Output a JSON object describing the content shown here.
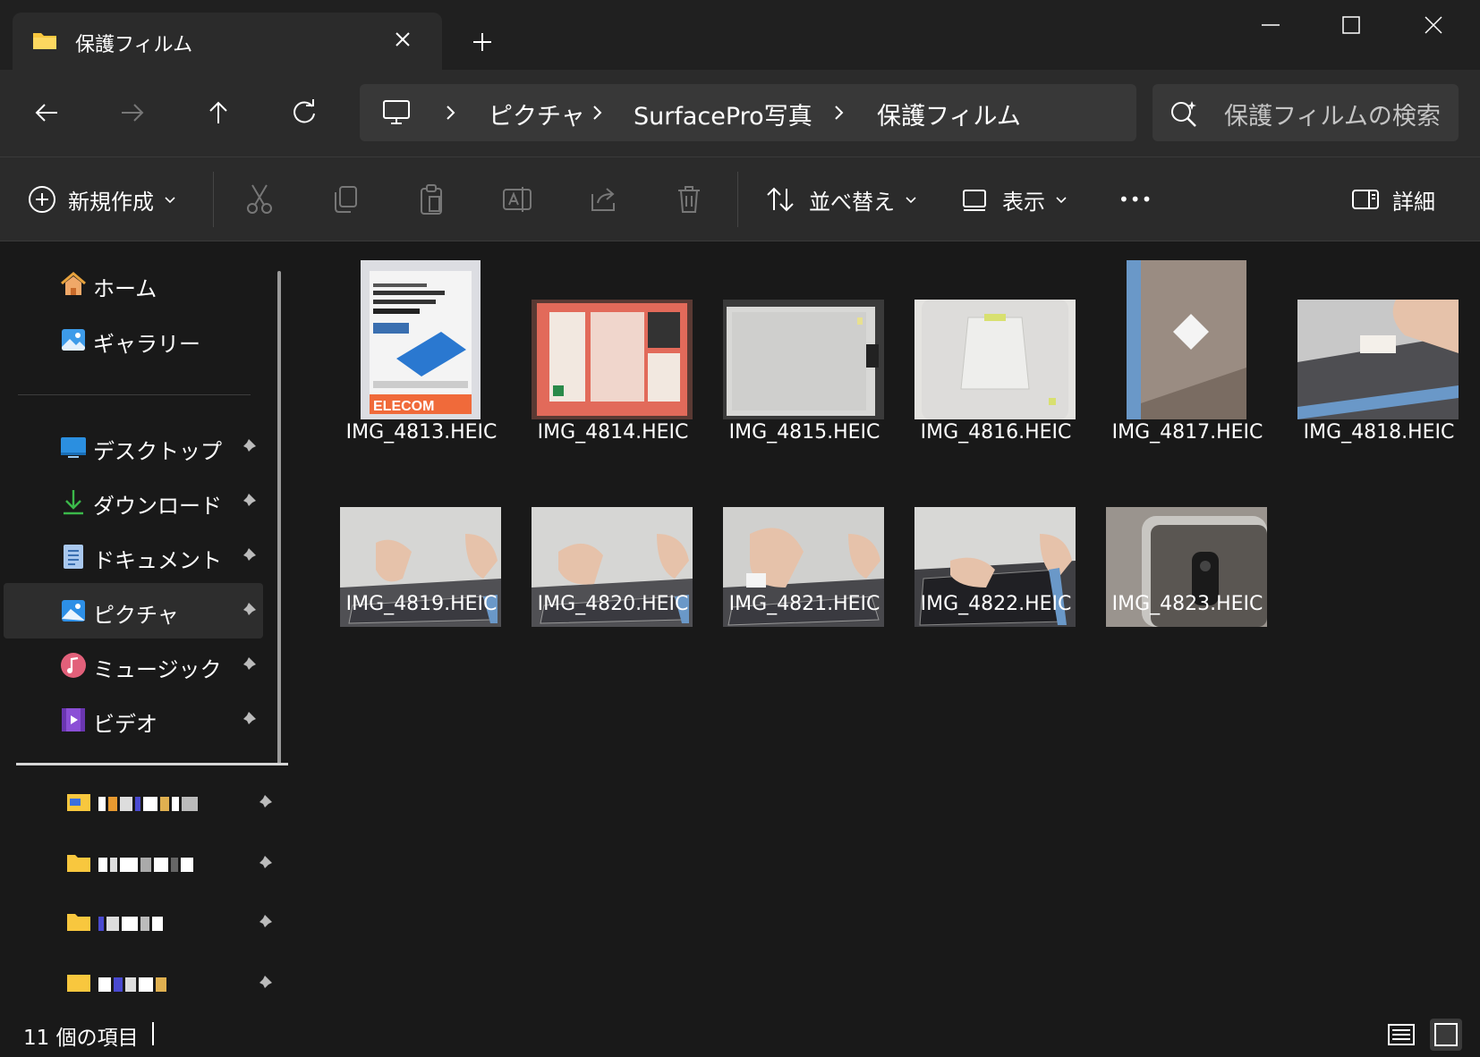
{
  "window": {
    "tab_title": "保護フィルム",
    "new_tab_glyph": "+"
  },
  "address_bar": {
    "crumbs": [
      "ピクチャ",
      "SurfacePro写真",
      "保護フィルム"
    ],
    "search_placeholder": "保護フィルムの検索"
  },
  "command_bar": {
    "new_label": "新規作成",
    "sort_label": "並べ替え",
    "view_label": "表示",
    "more_label": "•••",
    "details_label": "詳細"
  },
  "sidebar": {
    "top_items": [
      {
        "label": "ホーム",
        "icon": "home-icon"
      },
      {
        "label": "ギャラリー",
        "icon": "gallery-icon"
      }
    ],
    "quick_access": [
      {
        "label": "デスクトップ",
        "icon": "desktop-icon",
        "pinned": true
      },
      {
        "label": "ダウンロード",
        "icon": "download-icon",
        "pinned": true
      },
      {
        "label": "ドキュメント",
        "icon": "documents-icon",
        "pinned": true
      },
      {
        "label": "ピクチャ",
        "icon": "pictures-icon",
        "pinned": true,
        "selected": true
      },
      {
        "label": "ミュージック",
        "icon": "music-icon",
        "pinned": true
      },
      {
        "label": "ビデオ",
        "icon": "videos-icon",
        "pinned": true
      }
    ],
    "pinned_folders_count": 4
  },
  "files": [
    {
      "name": "IMG_4813.HEIC"
    },
    {
      "name": "IMG_4814.HEIC"
    },
    {
      "name": "IMG_4815.HEIC"
    },
    {
      "name": "IMG_4816.HEIC"
    },
    {
      "name": "IMG_4817.HEIC"
    },
    {
      "name": "IMG_4818.HEIC"
    },
    {
      "name": "IMG_4819.HEIC"
    },
    {
      "name": "IMG_4820.HEIC"
    },
    {
      "name": "IMG_4821.HEIC"
    },
    {
      "name": "IMG_4822.HEIC"
    },
    {
      "name": "IMG_4823.HEIC"
    }
  ],
  "status": {
    "item_count": "11 個の項目"
  },
  "colors": {
    "background": "#191919",
    "chrome": "#2b2b2b",
    "accent_folder": "#f8c73e",
    "accent_blue": "#4aa8f0"
  }
}
